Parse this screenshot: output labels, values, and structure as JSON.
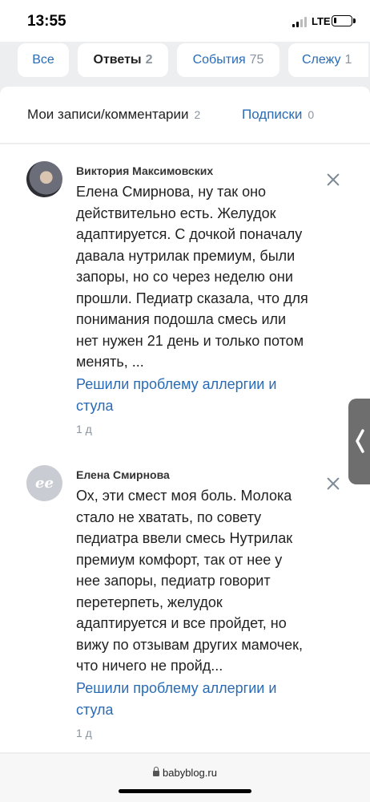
{
  "status_bar": {
    "time": "13:55",
    "network": "LTE",
    "battery_level": 0.15
  },
  "tabs": [
    {
      "label": "Все",
      "count": ""
    },
    {
      "label": "Ответы",
      "count": "2"
    },
    {
      "label": "События",
      "count": "75"
    },
    {
      "label": "Слежу",
      "count": "1"
    }
  ],
  "filters": [
    {
      "label": "Мои записи/комментарии",
      "count": "2"
    },
    {
      "label": "Подписки",
      "count": "0"
    }
  ],
  "comments": [
    {
      "author": "Виктория Максимовских",
      "text_lines": [
        "Елена Смирнова, ну так оно",
        "действительно есть. Желудок",
        "адаптируется. С дочкой поначалу",
        "давала нутрилак премиум, были",
        "запоры, но со через неделю они",
        "прошли. Педиатр сказала, что для",
        "понимания подошла смесь или",
        "нет нужен 21 день и только потом",
        "менять, ..."
      ],
      "link_lines": [
        "Решили проблему аллергии и",
        "стула"
      ],
      "time": "1 д"
    },
    {
      "author": "Елена Смирнова",
      "avatar_initials": "ее",
      "text_lines": [
        "Ох, эти смест моя боль. Молока",
        "стало не хватать, по совету",
        "педиатра ввели смесь Нутрилак",
        "премиум комфорт, так от нее у",
        "нее запоры, педиатр говорит",
        "перетерпеть, желудок",
        "адаптируется и все пройдет, но",
        "вижу по отзывам других мамочек,",
        "что ничего не пройд..."
      ],
      "link_lines": [
        "Решили проблему аллергии и",
        "стула"
      ],
      "time": "1 д"
    }
  ],
  "browser": {
    "url": "babyblog.ru"
  },
  "colors": {
    "link": "#2a6bb6",
    "muted": "#8b949f",
    "background": "#edeef0"
  }
}
